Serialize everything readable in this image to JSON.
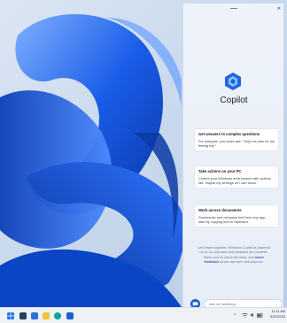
{
  "copilot": {
    "window_controls": {
      "minimize": "—",
      "close": "×"
    },
    "title": "Copilot",
    "cards": [
      {
        "title": "Get answers to complex questions",
        "body": "For example, you could ask: \"Help me plan for my fishing trip.\""
      },
      {
        "title": "Take actions on your PC",
        "body": "Control your Windows environment with actions like \"Adjust my settings so I can focus.\""
      },
      {
        "title": "Work across documents",
        "body": "Summarize and compose text from any app - start by copying text to clipboard."
      }
    ],
    "disclaimer": {
      "text": "Let's learn together. Windows Copilot is powered by AI, so surprises and mistakes are possible. Make sure to check the facts, and",
      "link": "share feedback",
      "suffix": "so we can learn and improve."
    },
    "chat_input": {
      "placeholder": "Ask me anything...",
      "new_topic_icon": "chat-bubble-icon"
    }
  },
  "taskbar": {
    "icons": [
      "windows-start-icon",
      "file-explorer-icon",
      "store-icon",
      "folder-icon",
      "edge-icon",
      "teams-icon"
    ],
    "tray": {
      "chevron": "^",
      "wifi": "wifi-icon",
      "volume": "volume-icon",
      "battery": "battery-icon"
    },
    "clock": {
      "time": "11:11 AM",
      "date": "5/23/2023"
    }
  },
  "colors": {
    "accent": "#1b5fd1",
    "panel_bg": "#eef3fa",
    "wallpaper_blue": "#0a4fd6"
  }
}
